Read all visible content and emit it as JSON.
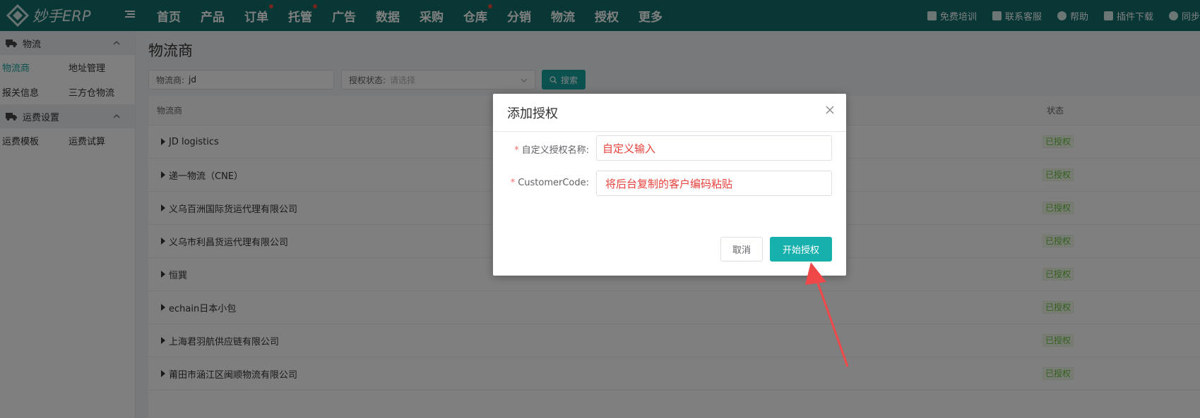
{
  "app": {
    "logo_text": "妙手ERP"
  },
  "nav": [
    {
      "label": "首页",
      "dot": false
    },
    {
      "label": "产品",
      "dot": false
    },
    {
      "label": "订单",
      "dot": true
    },
    {
      "label": "托管",
      "dot": true
    },
    {
      "label": "广告",
      "dot": false
    },
    {
      "label": "数据",
      "dot": false
    },
    {
      "label": "采购",
      "dot": false
    },
    {
      "label": "仓库",
      "dot": true
    },
    {
      "label": "分销",
      "dot": false
    },
    {
      "label": "物流",
      "dot": false
    },
    {
      "label": "授权",
      "dot": false
    },
    {
      "label": "更多",
      "dot": false
    }
  ],
  "utils": [
    "免费培训",
    "联系客服",
    "帮助",
    "插件下载",
    "同步"
  ],
  "sidebar": {
    "group1": {
      "title": "物流",
      "items": [
        "物流商",
        "地址管理",
        "报关信息",
        "三方仓物流"
      ],
      "active": "物流商"
    },
    "group2": {
      "title": "运费设置",
      "items": [
        "运费模板",
        "运费试算"
      ]
    }
  },
  "page": {
    "title": "物流商"
  },
  "filters": {
    "carrier_label": "物流商:",
    "carrier_value": "jd",
    "status_label": "授权状态:",
    "status_placeholder": "请选择",
    "search_label": "搜索"
  },
  "table": {
    "headers": [
      "物流商",
      "状态"
    ],
    "rows": [
      {
        "name": "JD logistics",
        "status": "已授权"
      },
      {
        "name": "递一物流（CNE）",
        "status": "已授权"
      },
      {
        "name": "义乌百洲国际货运代理有限公司",
        "status": "已授权"
      },
      {
        "name": "义乌市利昌货运代理有限公司",
        "status": "已授权"
      },
      {
        "name": "恒巽",
        "status": "已授权"
      },
      {
        "name": "echain日本小包",
        "status": "已授权"
      },
      {
        "name": "上海君羽航供应链有限公司",
        "status": "已授权"
      },
      {
        "name": "莆田市涵江区闽顺物流有限公司",
        "status": "已授权"
      }
    ]
  },
  "dialog": {
    "title": "添加授权",
    "fields": [
      {
        "label": "自定义授权名称:",
        "value": "自定义输入"
      },
      {
        "label": "CustomerCode:",
        "value": "将后台复制的客户编码粘贴"
      }
    ],
    "cancel_label": "取消",
    "ok_label": "开始授权"
  },
  "colors": {
    "topbar": "#136f6b",
    "accent": "#16a3a0",
    "annotation": "#f04848",
    "status_green": "#67c23a"
  }
}
